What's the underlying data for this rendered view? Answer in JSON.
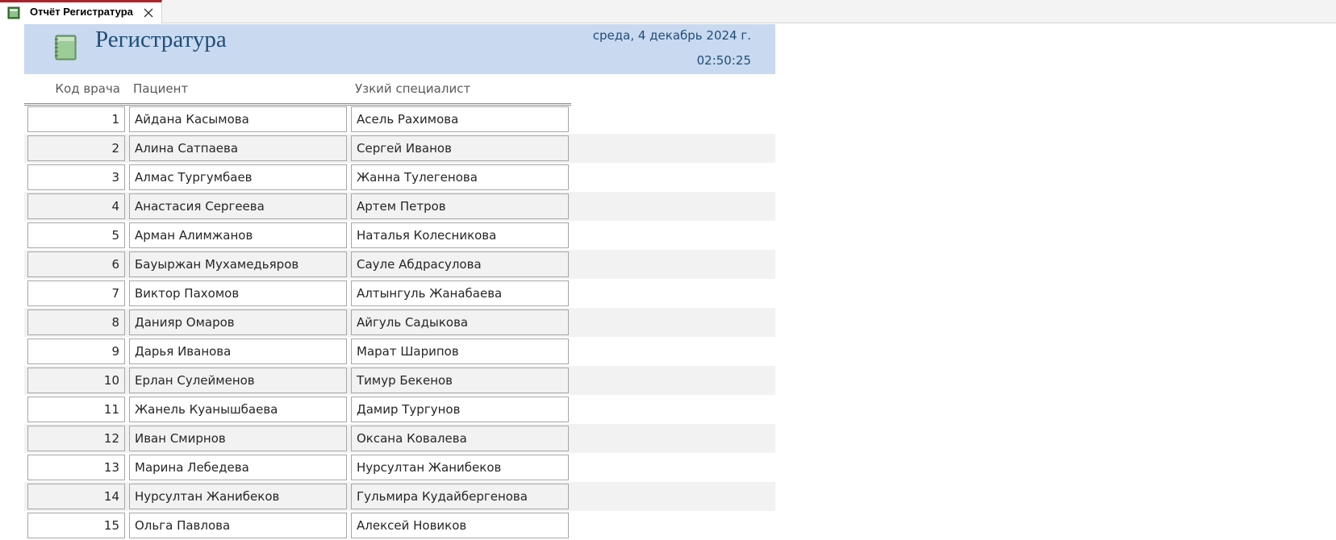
{
  "tab": {
    "label": "Отчёт Регистратура",
    "icon": "report-icon",
    "close_icon": "close-icon",
    "accent_color": "#a4262c"
  },
  "report": {
    "title": "Регистратура",
    "icon": "notebook-icon",
    "date": "среда, 4 декабрь 2024 г.",
    "time": "02:50:25",
    "header_color": "#c9d9ef",
    "title_color": "#1f4e79"
  },
  "columns": {
    "code": "Код врача",
    "patient": "Пациент",
    "specialist": "Узкий специалист"
  },
  "rows": [
    {
      "code": "1",
      "patient": "Айдана Касымова",
      "specialist": "Асель Рахимова"
    },
    {
      "code": "2",
      "patient": "Алина Сатпаева",
      "specialist": "Сергей Иванов"
    },
    {
      "code": "3",
      "patient": "Алмас Тургумбаев",
      "specialist": "Жанна Тулегенова"
    },
    {
      "code": "4",
      "patient": "Анастасия Сергеева",
      "specialist": "Артем Петров"
    },
    {
      "code": "5",
      "patient": "Арман Алимжанов",
      "specialist": "Наталья Колесникова"
    },
    {
      "code": "6",
      "patient": "Бауыржан Мухамедьяров",
      "specialist": "Сауле Абдрасулова"
    },
    {
      "code": "7",
      "patient": "Виктор Пахомов",
      "specialist": "Алтынгуль Жанабаева"
    },
    {
      "code": "8",
      "patient": "Данияр Омаров",
      "specialist": "Айгуль Садыкова"
    },
    {
      "code": "9",
      "patient": "Дарья Иванова",
      "specialist": "Марат Шарипов"
    },
    {
      "code": "10",
      "patient": "Ерлан Сулейменов",
      "specialist": "Тимур Бекенов"
    },
    {
      "code": "11",
      "patient": "Жанель Куанышбаева",
      "specialist": "Дамир Тургунов"
    },
    {
      "code": "12",
      "patient": "Иван Смирнов",
      "specialist": "Оксана Ковалева"
    },
    {
      "code": "13",
      "patient": "Марина Лебедева",
      "specialist": "Нурсултан Жанибеков"
    },
    {
      "code": "14",
      "patient": "Нурсултан Жанибеков",
      "specialist": "Гульмира Кудайбергенова"
    },
    {
      "code": "15",
      "patient": "Ольга Павлова",
      "specialist": "Алексей Новиков"
    }
  ]
}
